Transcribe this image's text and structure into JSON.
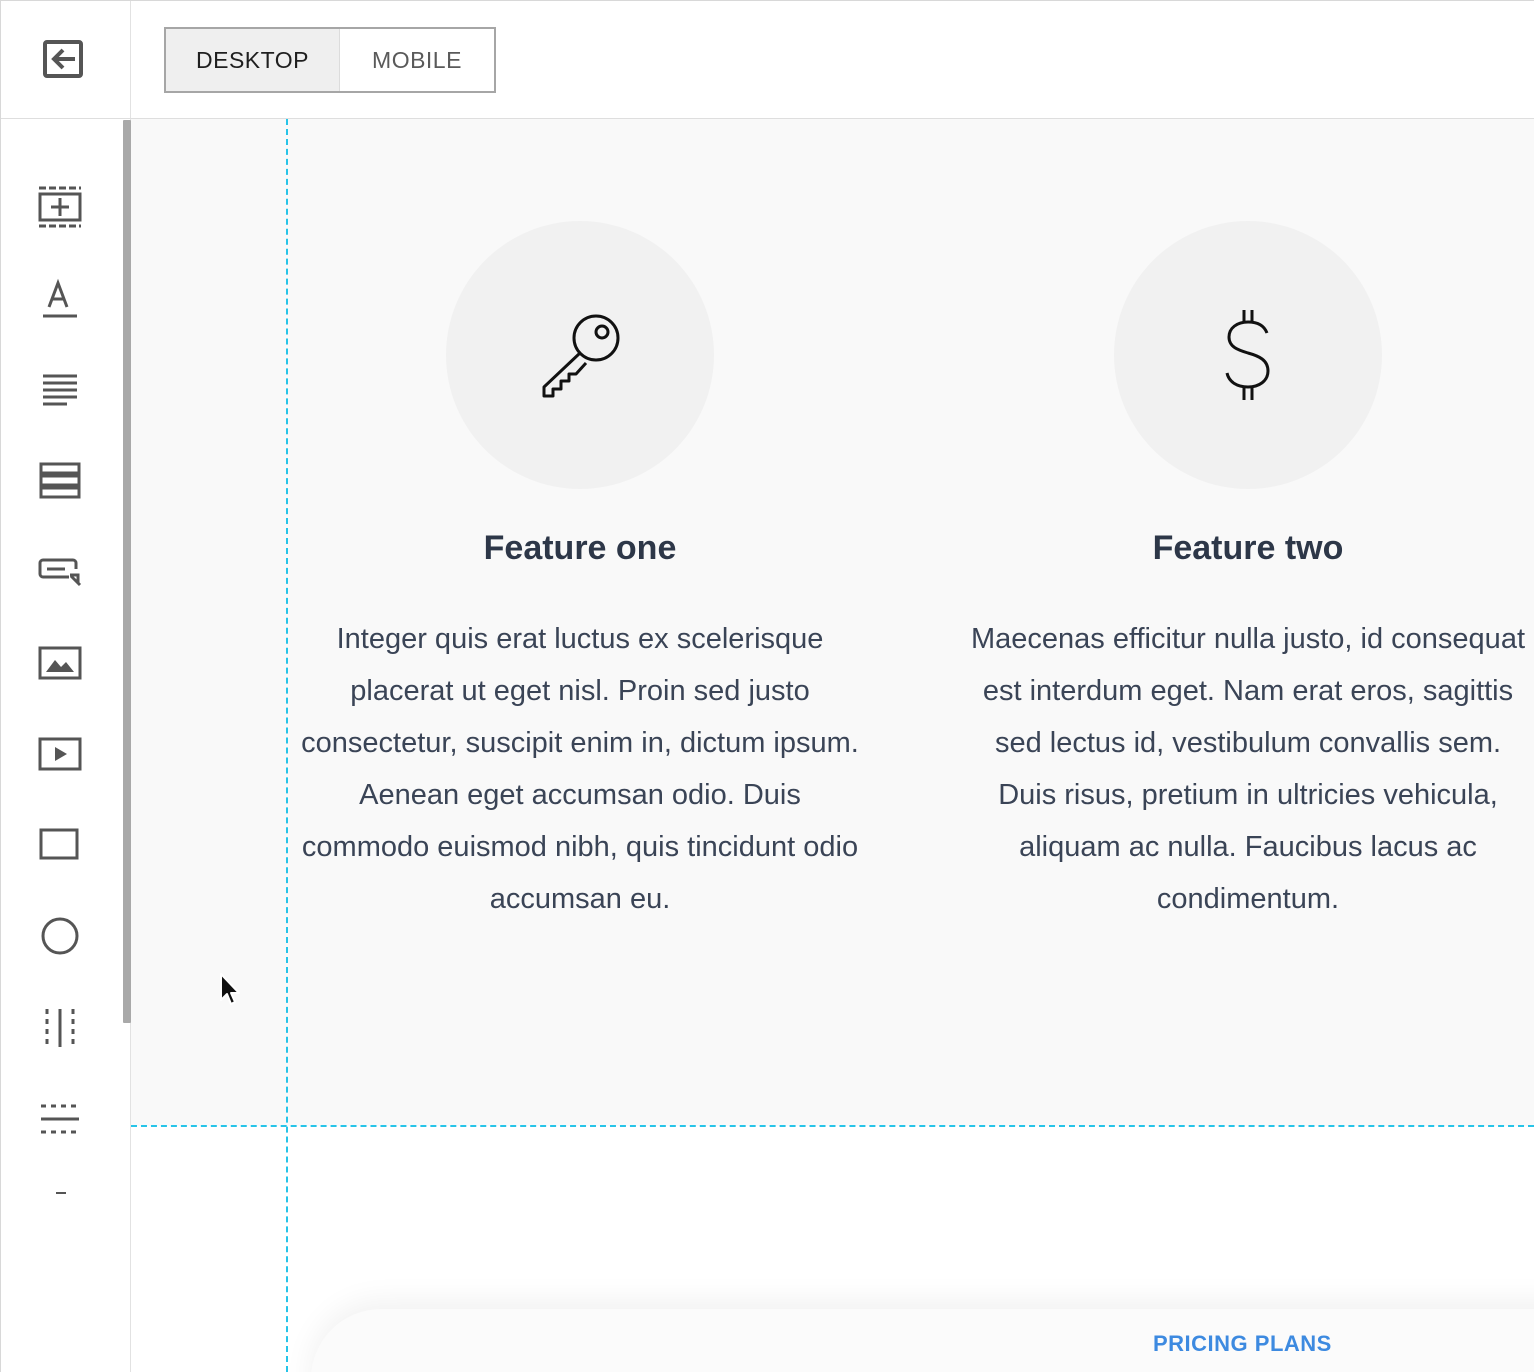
{
  "sidebar": {
    "exit_icon": "exit-icon",
    "tools": [
      {
        "name": "add-section-icon"
      },
      {
        "name": "heading-icon"
      },
      {
        "name": "paragraph-icon"
      },
      {
        "name": "list-icon"
      },
      {
        "name": "button-icon"
      },
      {
        "name": "image-icon"
      },
      {
        "name": "video-icon"
      },
      {
        "name": "rectangle-icon"
      },
      {
        "name": "circle-icon"
      },
      {
        "name": "vertical-divider-icon"
      },
      {
        "name": "horizontal-divider-icon"
      },
      {
        "name": "more-icon"
      }
    ]
  },
  "topbar": {
    "desktop_label": "DESKTOP",
    "mobile_label": "MOBILE"
  },
  "features": [
    {
      "icon": "key-icon",
      "title": "Feature one",
      "text": "Integer quis erat luctus ex scelerisque placerat ut eget nisl. Proin sed justo consectetur, suscipit enim in, dictum ipsum. Aenean eget accumsan odio. Duis commodo euismod nibh, quis tincidunt odio accumsan eu."
    },
    {
      "icon": "dollar-icon",
      "title": "Feature two",
      "text": "Maecenas efficitur nulla justo, id consequat est interdum eget. Nam erat eros, sagittis sed lectus id, vestibulum convallis sem. Duis risus, pretium in ultricies vehicula, aliquam ac nulla. Faucibus lacus ac condimentum."
    }
  ],
  "pricing": {
    "label": "PRICING PLANS"
  },
  "colors": {
    "guide": "#27c4e8",
    "accent": "#3d8ae0",
    "text": "#2d3748"
  }
}
